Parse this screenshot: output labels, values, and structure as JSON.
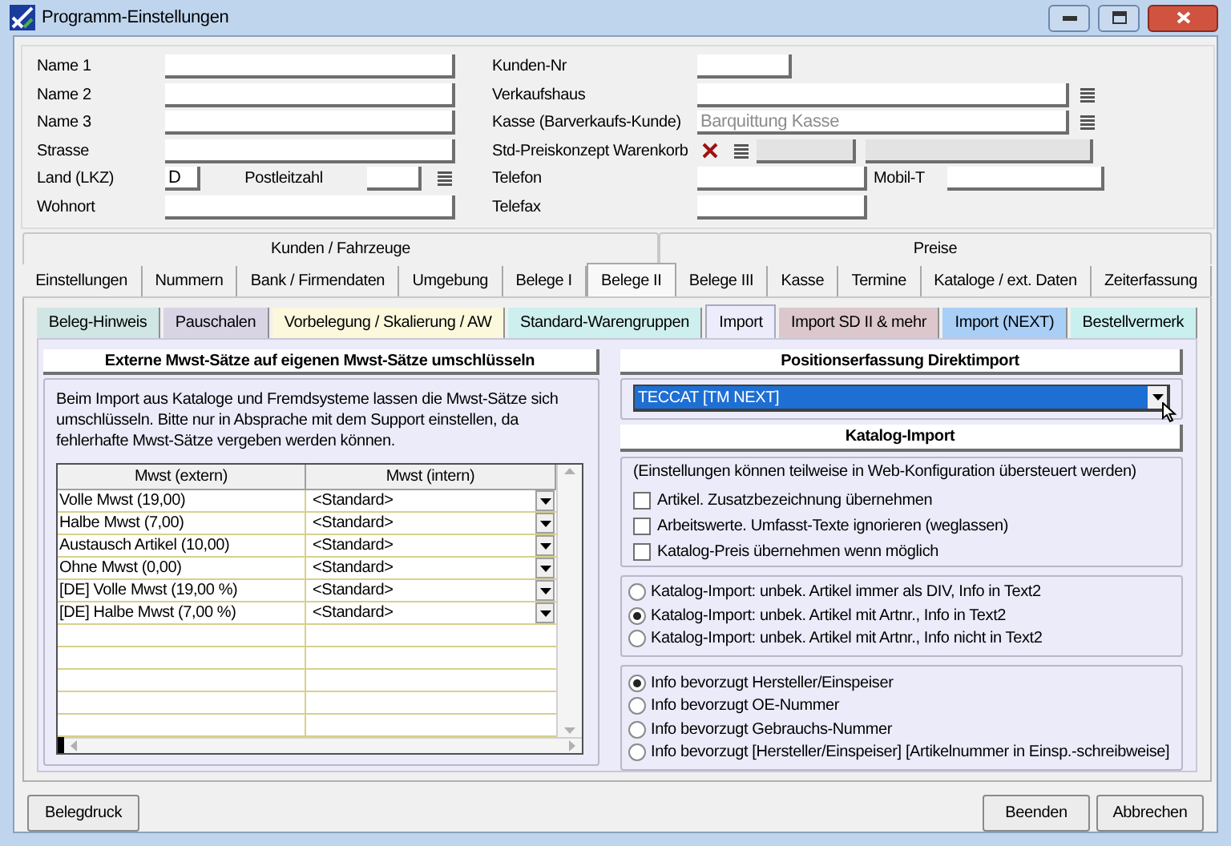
{
  "window": {
    "title": "Programm-Einstellungen"
  },
  "customer_left": [
    {
      "label": "Name 1",
      "kind": "text"
    },
    {
      "label": "Name 2",
      "kind": "text"
    },
    {
      "label": "Name 3",
      "kind": "text"
    },
    {
      "label": "Strasse",
      "kind": "text"
    },
    {
      "label": "Land (LKZ)",
      "kind": "country",
      "value": "D",
      "postal_label": "Postleitzahl"
    },
    {
      "label": "Wohnort",
      "kind": "text"
    }
  ],
  "customer_right": [
    {
      "label": "Kunden-Nr",
      "kind": "short"
    },
    {
      "label": "Verkaufshaus",
      "kind": "lookup"
    },
    {
      "label": "Kasse (Barverkaufs-Kunde)",
      "kind": "lookup",
      "placeholder": "Barquittung Kasse"
    },
    {
      "label": "Std-Preiskonzept Warenkorb",
      "kind": "price"
    },
    {
      "label": "Telefon",
      "kind": "phone",
      "extra_label": "Mobil-T"
    },
    {
      "label": "Telefax",
      "kind": "medium"
    }
  ],
  "tab_groups": [
    {
      "label": "Kunden / Fahrzeuge"
    },
    {
      "label": "Preise"
    }
  ],
  "tabs": [
    {
      "label": "Einstellungen",
      "selected": false
    },
    {
      "label": "Nummern",
      "selected": false
    },
    {
      "label": "Bank / Firmendaten",
      "selected": false
    },
    {
      "label": "Umgebung",
      "selected": false
    },
    {
      "label": "Belege I",
      "selected": false
    },
    {
      "label": "Belege II",
      "selected": true
    },
    {
      "label": "Belege III",
      "selected": false
    },
    {
      "label": "Kasse",
      "selected": false
    },
    {
      "label": "Termine",
      "selected": false
    },
    {
      "label": "Kataloge / ext. Daten",
      "selected": false
    },
    {
      "label": "Zeiterfassung",
      "selected": false
    }
  ],
  "subtabs": [
    {
      "label": "Beleg-Hinweis",
      "color": "#cfe6e4",
      "selected": false
    },
    {
      "label": "Pauschalen",
      "color": "#d9d4e4",
      "selected": false
    },
    {
      "label": "Vorbelegung / Skalierung / AW",
      "color": "#fbf8dc",
      "selected": false
    },
    {
      "label": "Standard-Warengruppen",
      "color": "#cdefed",
      "selected": false
    },
    {
      "label": "Import",
      "color": "#ececfa",
      "selected": true
    },
    {
      "label": "Import SD II & mehr",
      "color": "#dcc8cc",
      "selected": false
    },
    {
      "label": "Import (NEXT)",
      "color": "#a9cff7",
      "selected": false
    },
    {
      "label": "Bestellvermerk",
      "color": "#c9f0ee",
      "selected": false
    }
  ],
  "mwst_section": {
    "title": "Externe Mwst-Sätze auf eigenen Mwst-Sätze umschlüsseln",
    "description": "Beim Import aus Kataloge und Fremdsysteme lassen die Mwst-Sätze sich umschlüsseln. Bitte nur in Absprache mit dem Support einstellen, da fehlerhafte Mwst-Sätze vergeben werden können.",
    "table": {
      "columns": [
        "Mwst (extern)",
        "Mwst (intern)"
      ],
      "rows": [
        {
          "extern": "Volle Mwst (19,00)",
          "intern": "<Standard>"
        },
        {
          "extern": "Halbe Mwst (7,00)",
          "intern": "<Standard>"
        },
        {
          "extern": "Austausch Artikel (10,00)",
          "intern": "<Standard>"
        },
        {
          "extern": "Ohne Mwst (0,00)",
          "intern": "<Standard>"
        },
        {
          "extern": "[DE] Volle Mwst (19,00 %)",
          "intern": "<Standard>"
        },
        {
          "extern": "[DE] Halbe Mwst (7,00 %)",
          "intern": "<Standard>"
        }
      ]
    }
  },
  "direct_import": {
    "title": "Positionserfassung Direktimport",
    "combo": {
      "value": "TECCAT [TM NEXT]"
    }
  },
  "catalog_import": {
    "title": "Katalog-Import",
    "note": "(Einstellungen können teilweise in Web-Konfiguration übersteuert werden)",
    "checkboxes": [
      {
        "label": "Artikel. Zusatzbezeichnung übernehmen",
        "checked": false
      },
      {
        "label": "Arbeitswerte. Umfasst-Texte ignorieren (weglassen)",
        "checked": false
      },
      {
        "label": "Katalog-Preis übernehmen wenn möglich",
        "checked": false
      }
    ],
    "radio_groups": [
      [
        {
          "label": "Katalog-Import: unbek. Artikel immer als DIV, Info in Text2",
          "selected": false
        },
        {
          "label": "Katalog-Import: unbek. Artikel mit Artnr., Info in Text2",
          "selected": true
        },
        {
          "label": "Katalog-Import: unbek. Artikel mit Artnr., Info nicht in Text2",
          "selected": false
        }
      ],
      [
        {
          "label": "Info bevorzugt Hersteller/Einspeiser",
          "selected": true
        },
        {
          "label": "Info bevorzugt OE-Nummer",
          "selected": false
        },
        {
          "label": "Info bevorzugt Gebrauchs-Nummer",
          "selected": false
        },
        {
          "label": "Info bevorzugt [Hersteller/Einspeiser] [Artikelnummer in Einsp.-schreibweise]",
          "selected": false
        }
      ]
    ]
  },
  "buttons_left": [
    "Belegdruck"
  ],
  "buttons_right": [
    "Beenden",
    "Abbrechen"
  ]
}
